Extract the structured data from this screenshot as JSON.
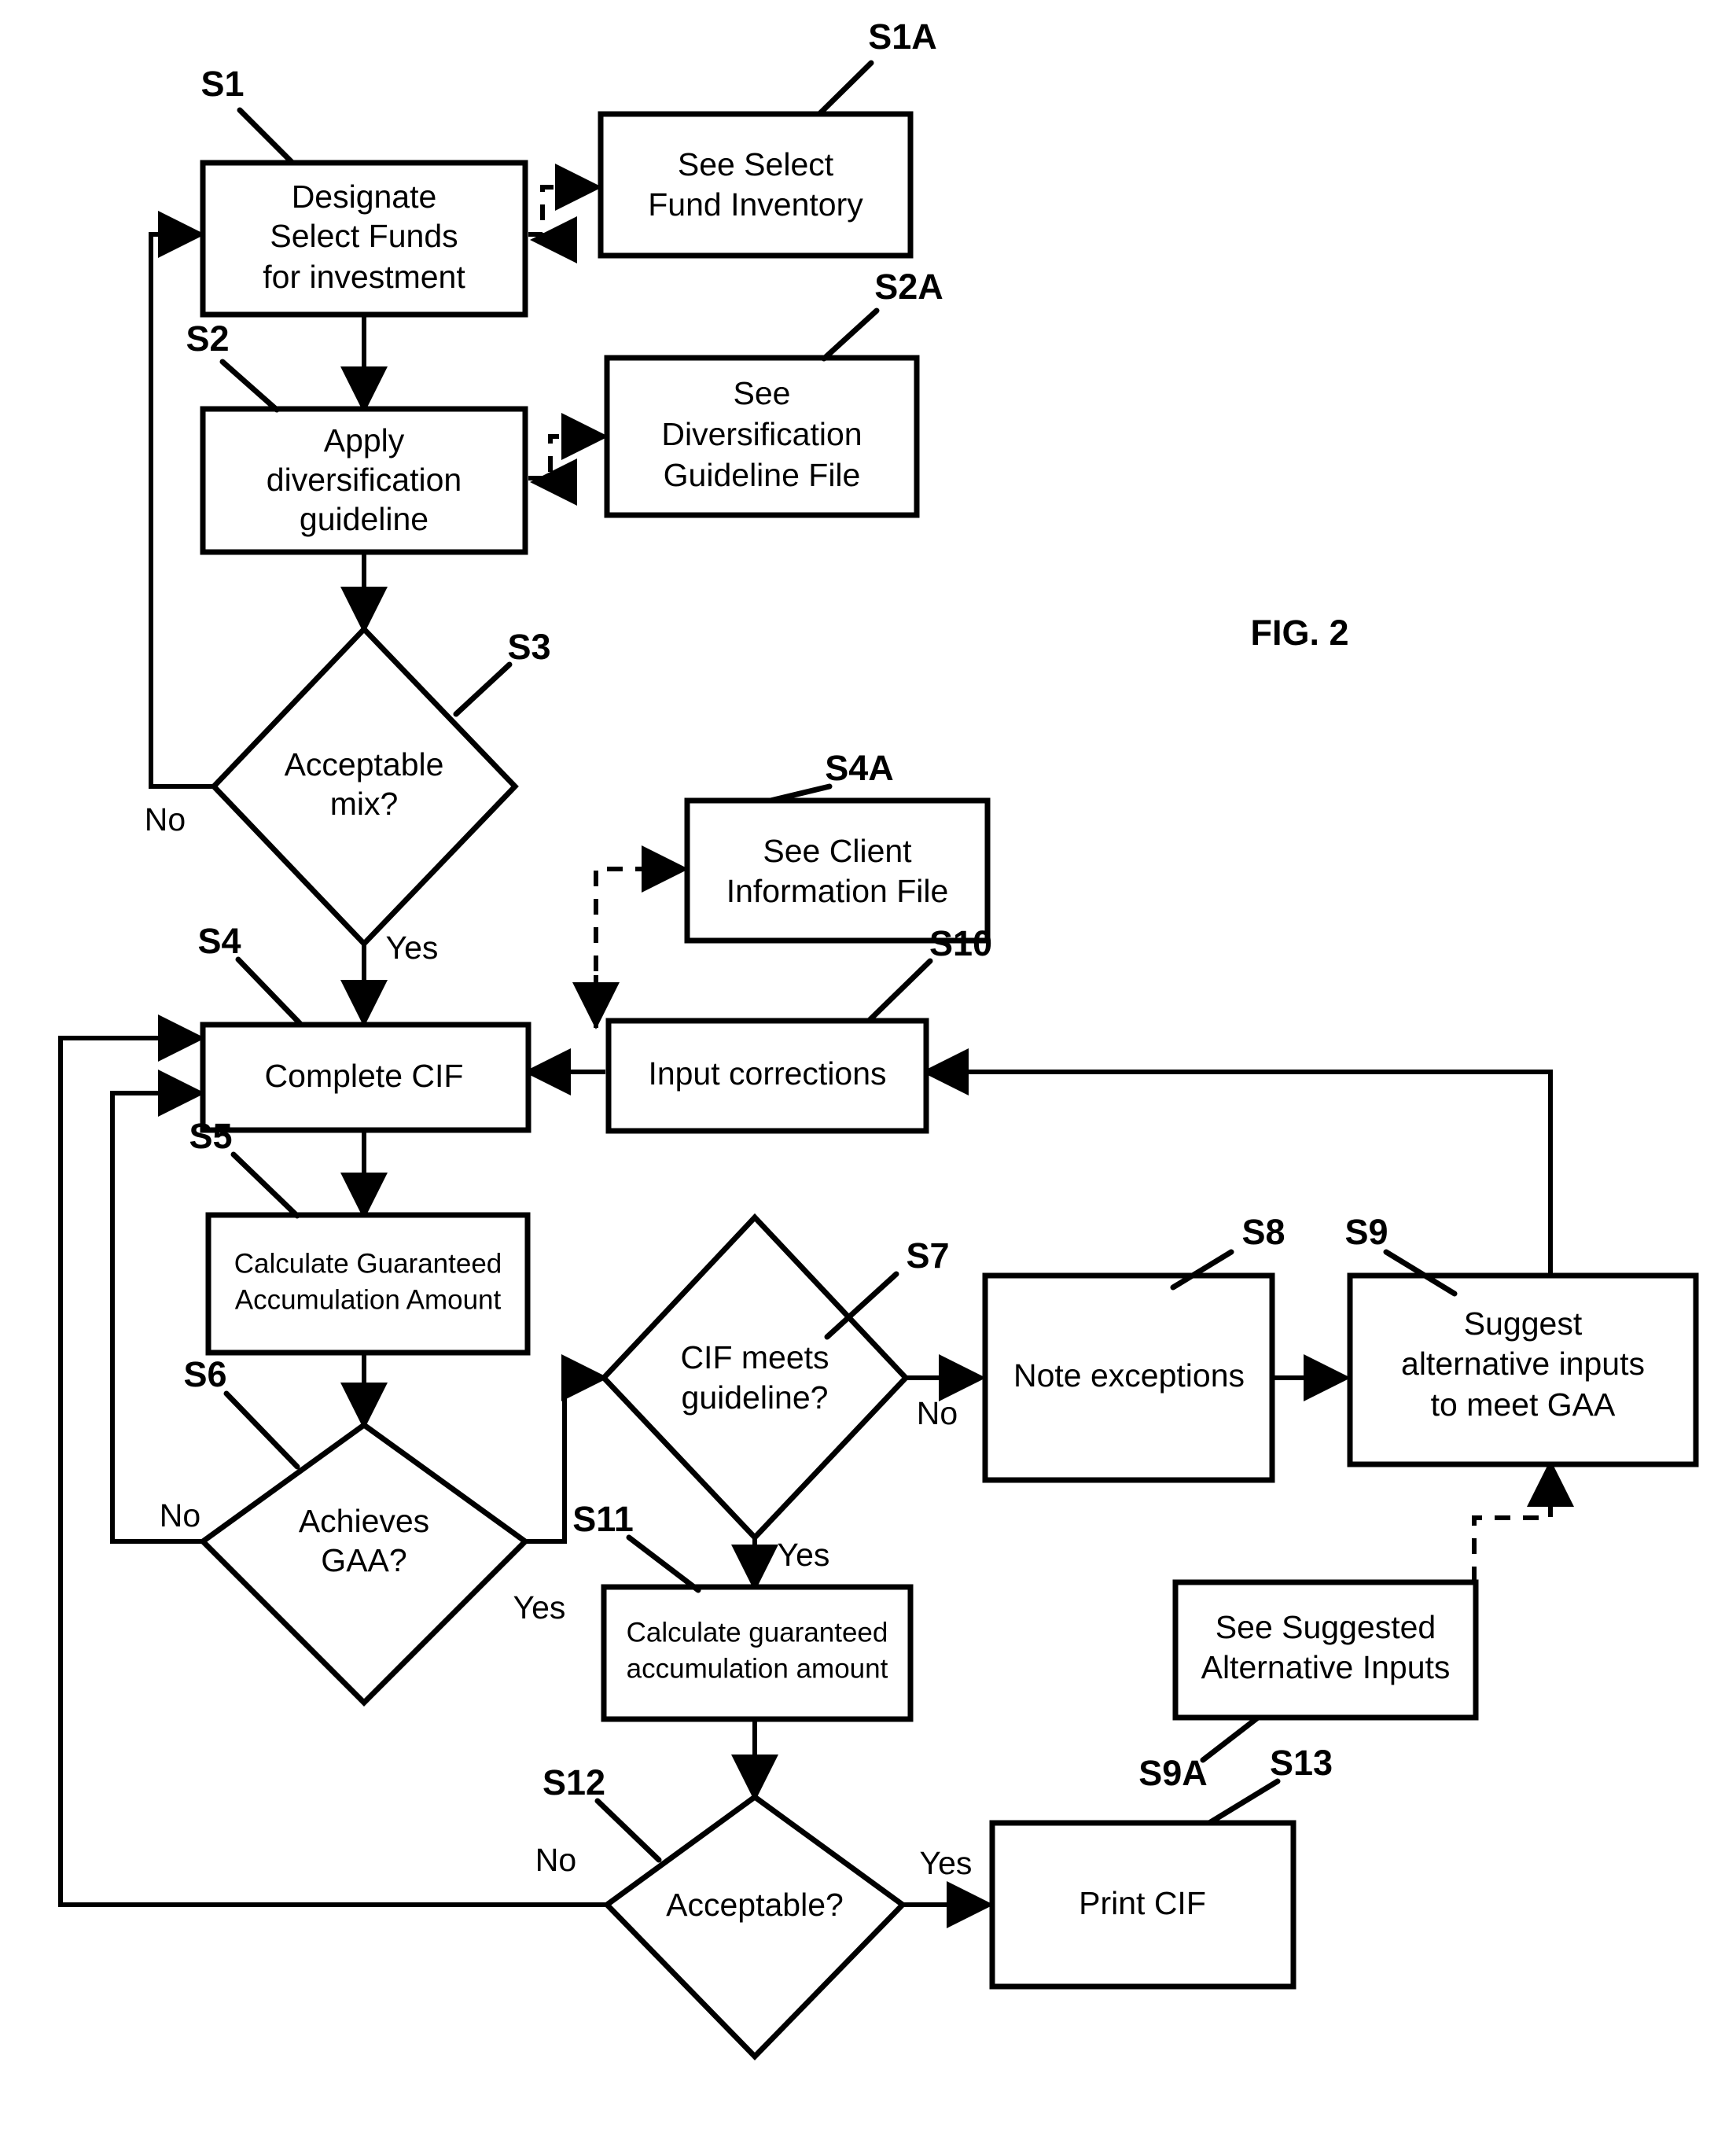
{
  "figure": {
    "label": "FIG. 2",
    "title": "Flowchart of guaranteed accumulation amount investment process"
  },
  "nodes": {
    "s1": {
      "ref": "S1",
      "type": "process",
      "lines": [
        "Designate",
        "Select Funds",
        "for investment"
      ]
    },
    "s1a": {
      "ref": "S1A",
      "type": "reference-file",
      "lines": [
        "See Select",
        "Fund Inventory"
      ]
    },
    "s2": {
      "ref": "S2",
      "type": "process",
      "lines": [
        "Apply",
        "diversification",
        "guideline"
      ]
    },
    "s2a": {
      "ref": "S2A",
      "type": "reference-file",
      "lines": [
        "See",
        "Diversification",
        "Guideline File"
      ]
    },
    "s3": {
      "ref": "S3",
      "type": "decision",
      "lines": [
        "Acceptable",
        "mix?"
      ],
      "branch_no": "No",
      "branch_yes": "Yes"
    },
    "s4": {
      "ref": "S4",
      "type": "process",
      "lines": [
        "Complete CIF"
      ]
    },
    "s4a": {
      "ref": "S4A",
      "type": "reference-file",
      "lines": [
        "See Client",
        "Information File"
      ]
    },
    "s5": {
      "ref": "S5",
      "type": "process",
      "lines": [
        "Calculate Guaranteed",
        "Accumulation Amount"
      ]
    },
    "s6": {
      "ref": "S6",
      "type": "decision",
      "lines": [
        "Achieves",
        "GAA?"
      ],
      "branch_no": "No",
      "branch_yes": "Yes"
    },
    "s7": {
      "ref": "S7",
      "type": "decision",
      "lines": [
        "CIF meets",
        "guideline?"
      ],
      "branch_no": "No",
      "branch_yes": "Yes"
    },
    "s8": {
      "ref": "S8",
      "type": "process",
      "lines": [
        "Note exceptions"
      ]
    },
    "s9": {
      "ref": "S9",
      "type": "process",
      "lines": [
        "Suggest",
        "alternative inputs",
        "to meet GAA"
      ]
    },
    "s9a": {
      "ref": "S9A",
      "type": "reference-file",
      "lines": [
        "See Suggested",
        "Alternative Inputs"
      ]
    },
    "s10": {
      "ref": "S10",
      "type": "process",
      "lines": [
        "Input  corrections"
      ]
    },
    "s11": {
      "ref": "S11",
      "type": "process",
      "lines": [
        "Calculate guaranteed",
        "accumulation amount"
      ]
    },
    "s12": {
      "ref": "S12",
      "type": "decision",
      "lines": [
        "Acceptable?"
      ],
      "branch_no": "No",
      "branch_yes": "Yes"
    },
    "s13": {
      "ref": "S13",
      "type": "process",
      "lines": [
        "Print CIF"
      ]
    }
  },
  "colors": {
    "stroke": "#000000",
    "fill": "#ffffff",
    "background": "#ffffff"
  }
}
